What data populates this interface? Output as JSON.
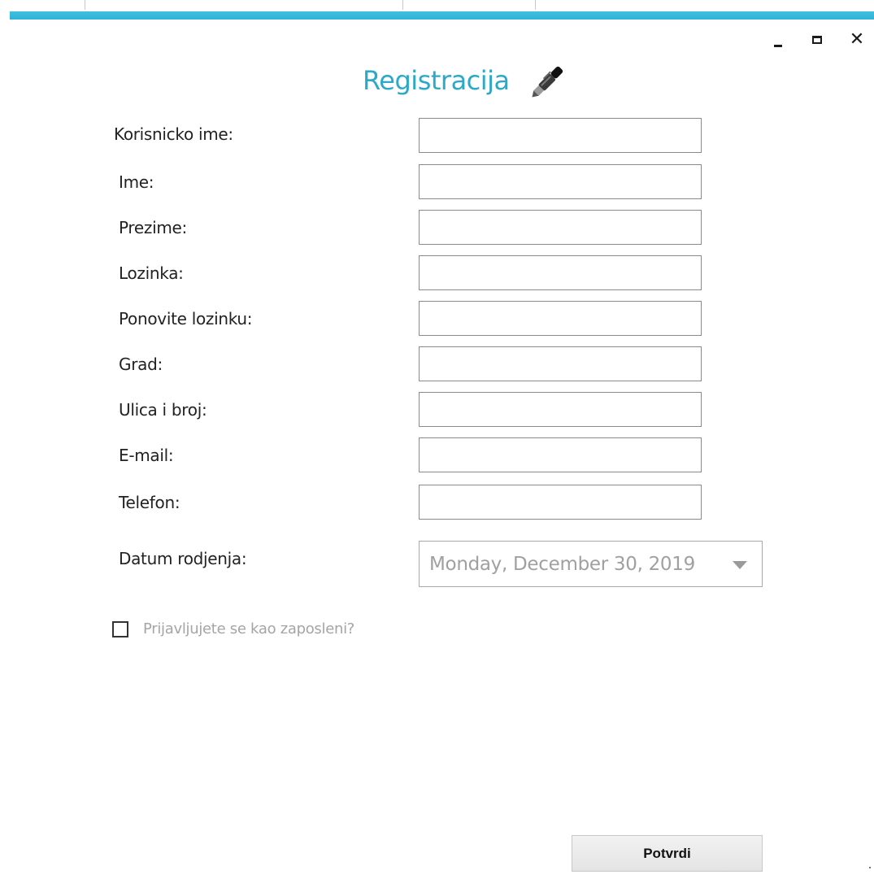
{
  "window": {
    "title": "Registracija",
    "controls": {
      "minimize": "minimize",
      "maximize": "maximize",
      "close": "✕"
    },
    "accent_color": "#2fb2d6",
    "title_color": "#2ba9c9"
  },
  "form": {
    "fields": [
      {
        "label": "Korisnicko ime:",
        "value": ""
      },
      {
        "label": "Ime:",
        "value": ""
      },
      {
        "label": "Prezime:",
        "value": ""
      },
      {
        "label": "Lozinka:",
        "value": ""
      },
      {
        "label": "Ponovite lozinku:",
        "value": ""
      },
      {
        "label": "Grad:",
        "value": ""
      },
      {
        "label": "Ulica i broj:",
        "value": ""
      },
      {
        "label": "E-mail:",
        "value": ""
      },
      {
        "label": "Telefon:",
        "value": ""
      }
    ],
    "birth_date": {
      "label": "Datum rodjenja:",
      "value": "Monday, December 30, 2019"
    },
    "employee_checkbox": {
      "label": "Prijavljujete se kao zaposleni?",
      "checked": false
    },
    "submit_label": "Potvrdi"
  },
  "icons": {
    "title_icon": "pen-icon",
    "date_dropdown": "chevron-down-icon"
  }
}
